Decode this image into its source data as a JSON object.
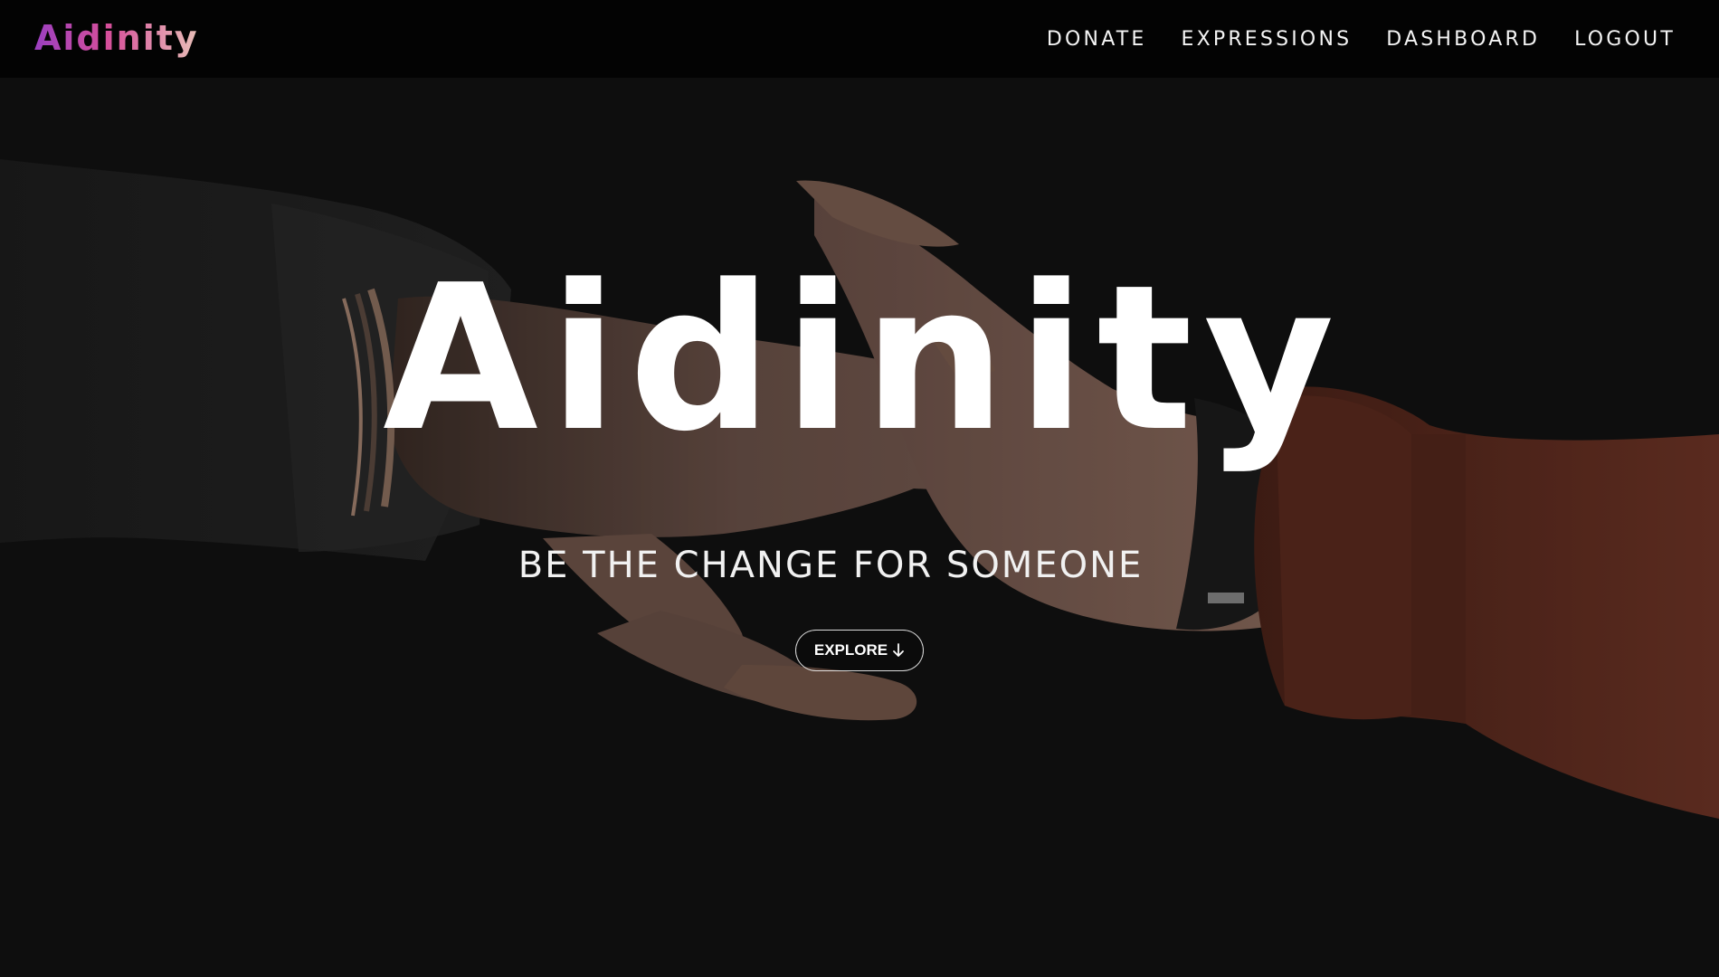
{
  "navbar": {
    "brand": "Aidinity",
    "links": [
      {
        "label": "DONATE"
      },
      {
        "label": "EXPRESSIONS"
      },
      {
        "label": "DASHBOARD"
      },
      {
        "label": "LOGOUT"
      }
    ]
  },
  "hero": {
    "title": "Aidinity",
    "tagline": "BE THE CHANGE FOR SOMEONE",
    "explore_label": "EXPLORE",
    "explore_icon": "arrow-down-icon",
    "background_image": "two-hands-reaching-photo"
  },
  "colors": {
    "brand_gradient_start": "#9b3fc0",
    "brand_gradient_mid": "#d64f9a",
    "brand_gradient_end": "#e9c0b8",
    "navbar_bg": "#030303",
    "hero_bg": "#121212"
  }
}
